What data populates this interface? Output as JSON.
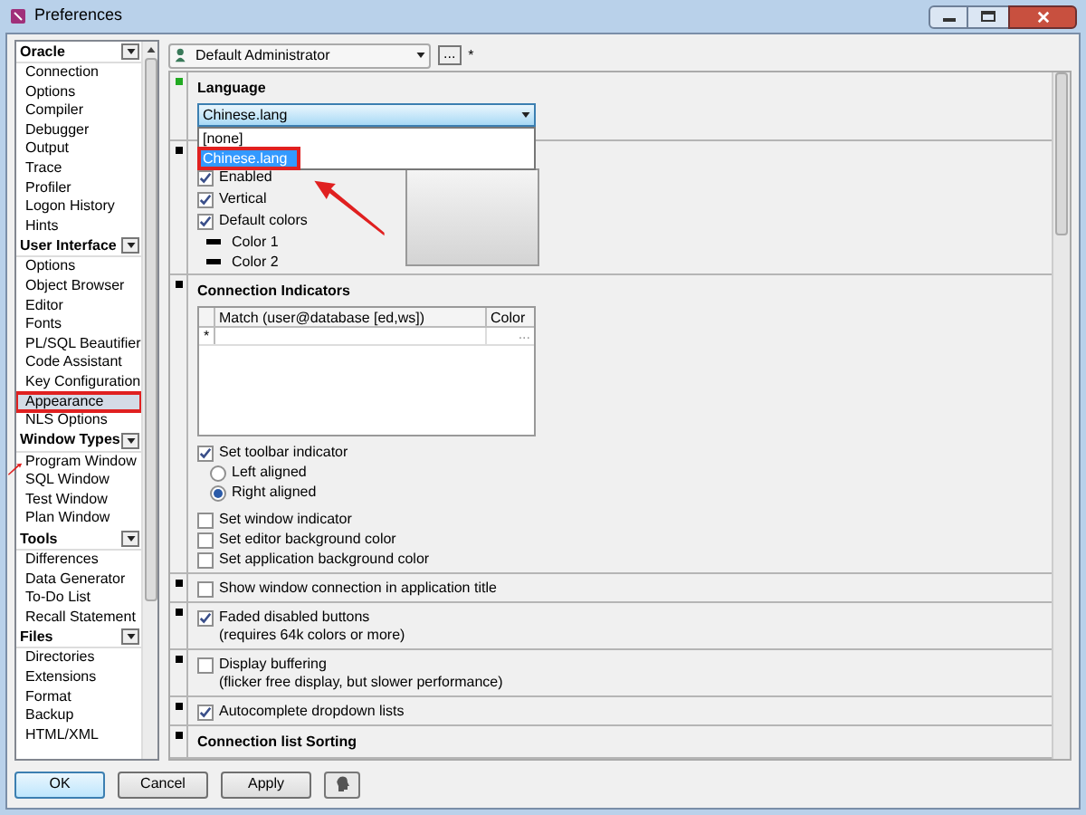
{
  "window": {
    "title": "Preferences"
  },
  "sidebar": {
    "groups": [
      {
        "label": "Oracle",
        "items": [
          {
            "label": "Connection",
            "selected": false,
            "highlighted": false
          },
          {
            "label": "Options",
            "selected": false,
            "highlighted": false
          },
          {
            "label": "Compiler",
            "selected": false,
            "highlighted": false
          },
          {
            "label": "Debugger",
            "selected": false,
            "highlighted": false
          },
          {
            "label": "Output",
            "selected": false,
            "highlighted": false
          },
          {
            "label": "Trace",
            "selected": false,
            "highlighted": false
          },
          {
            "label": "Profiler",
            "selected": false,
            "highlighted": false
          },
          {
            "label": "Logon History",
            "selected": false,
            "highlighted": false
          },
          {
            "label": "Hints",
            "selected": false,
            "highlighted": false
          }
        ]
      },
      {
        "label": "User Interface",
        "items": [
          {
            "label": "Options",
            "selected": false,
            "highlighted": false
          },
          {
            "label": "Object Browser",
            "selected": false,
            "highlighted": false
          },
          {
            "label": "Editor",
            "selected": false,
            "highlighted": false
          },
          {
            "label": "Fonts",
            "selected": false,
            "highlighted": false
          },
          {
            "label": "PL/SQL Beautifier",
            "selected": false,
            "highlighted": false
          },
          {
            "label": "Code Assistant",
            "selected": false,
            "highlighted": false
          },
          {
            "label": "Key Configuration",
            "selected": false,
            "highlighted": false
          },
          {
            "label": "Appearance",
            "selected": true,
            "highlighted": true
          },
          {
            "label": "NLS Options",
            "selected": false,
            "highlighted": false
          }
        ]
      },
      {
        "label": "Window Types",
        "items": [
          {
            "label": "Program Window",
            "selected": false,
            "highlighted": false
          },
          {
            "label": "SQL Window",
            "selected": false,
            "highlighted": false
          },
          {
            "label": "Test Window",
            "selected": false,
            "highlighted": false
          },
          {
            "label": "Plan Window",
            "selected": false,
            "highlighted": false
          }
        ]
      },
      {
        "label": "Tools",
        "items": [
          {
            "label": "Differences",
            "selected": false,
            "highlighted": false
          },
          {
            "label": "Data Generator",
            "selected": false,
            "highlighted": false
          },
          {
            "label": "To-Do List",
            "selected": false,
            "highlighted": false
          },
          {
            "label": "Recall Statement",
            "selected": false,
            "highlighted": false
          }
        ]
      },
      {
        "label": "Files",
        "items": [
          {
            "label": "Directories",
            "selected": false,
            "highlighted": false
          },
          {
            "label": "Extensions",
            "selected": false,
            "highlighted": false
          },
          {
            "label": "Format",
            "selected": false,
            "highlighted": false
          },
          {
            "label": "Backup",
            "selected": false,
            "highlighted": false
          },
          {
            "label": "HTML/XML",
            "selected": false,
            "highlighted": false
          }
        ]
      }
    ]
  },
  "profile": {
    "value": "Default Administrator",
    "more_button": "...",
    "modified_mark": "*"
  },
  "language": {
    "title": "Language",
    "modified": true,
    "value": "Chinese.lang",
    "options": [
      {
        "label": "[none]",
        "selected": false,
        "highlighted": false
      },
      {
        "label": "Chinese.lang",
        "selected": true,
        "highlighted": true
      }
    ]
  },
  "gradient": {
    "modified": false,
    "checks": [
      {
        "label": "Enabled",
        "checked": true
      },
      {
        "label": "Vertical",
        "checked": true
      },
      {
        "label": "Default colors",
        "checked": true
      }
    ],
    "colors": [
      {
        "label": "Color 1",
        "color": "#000000"
      },
      {
        "label": "Color 2",
        "color": "#000000"
      }
    ]
  },
  "connection_indicators": {
    "title": "Connection Indicators",
    "modified": false,
    "columns": [
      "Match (user@database [ed,ws])",
      "Color"
    ],
    "new_row_mark": "*",
    "row_button": "...",
    "toolbar": {
      "label": "Set toolbar indicator",
      "checked": true
    },
    "alignment": [
      {
        "label": "Left aligned",
        "selected": false
      },
      {
        "label": "Right aligned",
        "selected": true
      }
    ],
    "checks": [
      {
        "label": "Set window indicator",
        "checked": false
      },
      {
        "label": "Set editor background color",
        "checked": false
      },
      {
        "label": "Set application background color",
        "checked": false
      }
    ]
  },
  "options": [
    {
      "label": "Show window connection in application title",
      "checked": false,
      "modified": false
    },
    {
      "label": "Faded disabled buttons",
      "note": "(requires 64k colors or more)",
      "checked": true,
      "modified": false
    },
    {
      "label": "Display buffering",
      "note": "(flicker free display, but slower performance)",
      "checked": false,
      "modified": false
    },
    {
      "label": "Autocomplete dropdown lists",
      "checked": true,
      "modified": false
    }
  ],
  "sorting": {
    "title": "Connection list Sorting",
    "modified": false
  },
  "buttons": [
    {
      "label": "OK",
      "kind": "default"
    },
    {
      "label": "Cancel",
      "kind": "normal"
    },
    {
      "label": "Apply",
      "kind": "normal"
    },
    {
      "kind": "icon"
    }
  ]
}
